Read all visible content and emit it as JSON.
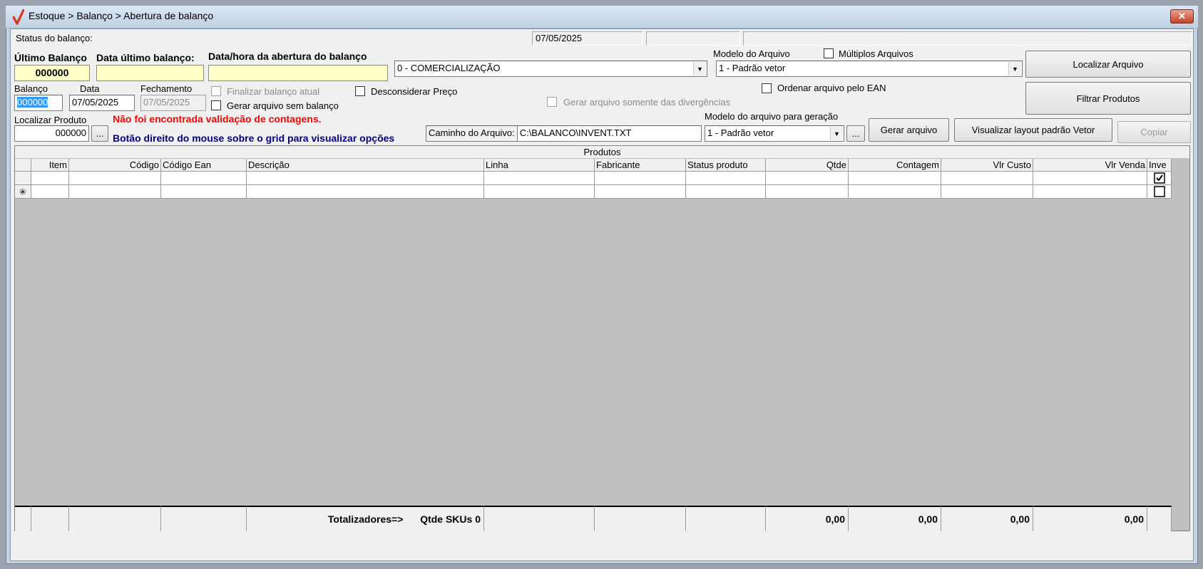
{
  "window": {
    "title": "Estoque > Balanço > Abertura de balanço",
    "close_label": "✕"
  },
  "status": {
    "label": "Status do balanço:",
    "date": "07/05/2025",
    "field2": "",
    "field3": ""
  },
  "ultimo_balanco": {
    "label": "Último Balanço",
    "value": "000000"
  },
  "data_ultimo": {
    "label": "Data último balanço:",
    "value": ""
  },
  "data_abertura": {
    "label": "Data/hora da abertura do balanço",
    "value": ""
  },
  "finalidade": {
    "selected": "0 - COMERCIALIZAÇÃO"
  },
  "modelo_arquivo": {
    "label": "Modelo do Arquivo",
    "selected": "1 - Padrão vetor"
  },
  "multiplos": {
    "label": "Múltiplos Arquivos",
    "checked": false
  },
  "ordenar_ean": {
    "label": "Ordenar arquivo pelo EAN",
    "checked": false
  },
  "balanco": {
    "label": "Balanço",
    "value": "000000"
  },
  "data": {
    "label": "Data",
    "value": "07/05/2025"
  },
  "fechamento": {
    "label": "Fechamento",
    "value": "07/05/2025"
  },
  "finalizar": {
    "label": "Finalizar balanço atual"
  },
  "gerar_sem": {
    "label": "Gerar arquivo sem balanço"
  },
  "desconsiderar": {
    "label": "Desconsiderar Preço"
  },
  "divergencias": {
    "label": "Gerar arquivo somente das divergências"
  },
  "localizar_produto": {
    "label": "Localizar Produto",
    "value": "000000",
    "browse": "..."
  },
  "messages": {
    "validacao": "Não foi encontrada validação de contagens.",
    "dica": "Botão direito do mouse sobre o grid para visualizar opções"
  },
  "caminho": {
    "label": "Caminho do Arquivo:",
    "value": "C:\\BALANCO\\INVENT.TXT"
  },
  "modelo_geracao": {
    "label": "Modelo do arquivo para geração",
    "selected": "1 - Padrão vetor",
    "browse": "..."
  },
  "buttons": {
    "localizar_arquivo": "Localizar Arquivo",
    "filtrar_produtos": "Filtrar Produtos",
    "gerar_arquivo": "Gerar arquivo",
    "visualizar_layout": "Visualizar layout padrão Vetor",
    "copiar": "Copiar"
  },
  "grid": {
    "caption": "Produtos",
    "columns": [
      "Item",
      "Código",
      "Código Ean",
      "Descrição",
      "Linha",
      "Fabricante",
      "Status produto",
      "Qtde",
      "Contagem",
      "Vlr Custo",
      "Vlr Venda",
      "Inve"
    ],
    "new_row_marker": "✳",
    "footer": {
      "totalizadores": "Totalizadores=>",
      "qtde_skus": "Qtde SKUs 0",
      "qtde": "0,00",
      "contagem": "0,00",
      "vlr_custo": "0,00",
      "vlr_venda": "0,00"
    }
  }
}
